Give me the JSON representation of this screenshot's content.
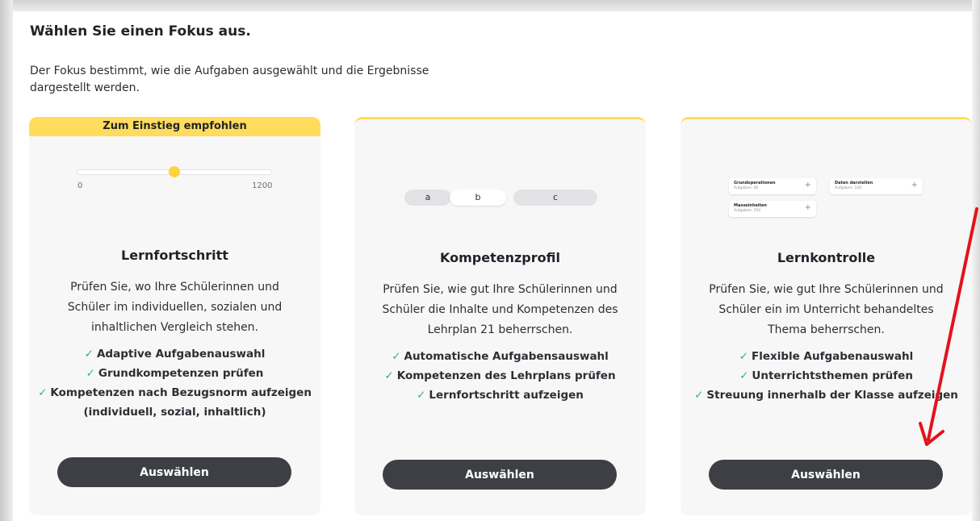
{
  "header": {
    "title": "Wählen Sie einen Fokus aus.",
    "description": "Der Fokus bestimmt, wie die Aufgaben ausgewählt und die Ergebnisse dargestellt werden."
  },
  "colors": {
    "accent_yellow": "#ffdc5c",
    "button_dark": "#3d3f44",
    "check_teal": "#2ab3a2",
    "arrow_red": "#e3131b"
  },
  "cards": [
    {
      "badge": "Zum Einstieg empfohlen",
      "illustration": {
        "slider_min": "0",
        "slider_max": "1200",
        "slider_value": 600
      },
      "title": "Lernfortschritt",
      "text": "Prüfen Sie, wo Ihre Schülerinnen und Schüler im individuellen, sozialen und inhaltlichen Vergleich stehen.",
      "features": [
        "Adaptive Aufgabenauswahl",
        "Grundkompetenzen prüfen",
        "Kompetenzen nach Bezugsnorm aufzeigen (individuell, sozial, inhaltlich)"
      ],
      "button": "Auswählen"
    },
    {
      "illustration": {
        "segments": [
          "a",
          "b",
          "c"
        ],
        "selected": "b"
      },
      "title": "Kompetenzprofil",
      "text": "Prüfen Sie, wie gut Ihre Schülerinnen und Schüler die Inhalte und Kompetenzen des Lehrplan 21 beherrschen.",
      "features": [
        "Automatische Aufgabensauswahl",
        "Kompetenzen des Lehrplans prüfen",
        "Lernfortschritt aufzeigen"
      ],
      "button": "Auswählen"
    },
    {
      "illustration": {
        "topics": [
          {
            "name": "Grundoperationen",
            "sub": "Aufgaben: 40"
          },
          {
            "name": "Daten darstellen",
            "sub": "Aufgaben: 120"
          },
          {
            "name": "Masseinheiten",
            "sub": "Aufgaben: 250"
          }
        ]
      },
      "title": "Lernkontrolle",
      "text": "Prüfen Sie, wie gut Ihre Schülerinnen und Schüler ein im Unterricht behandeltes Thema beherrschen.",
      "features": [
        "Flexible Aufgabenauswahl",
        "Unterrichtsthemen prüfen",
        "Streuung innerhalb der Klasse aufzeigen"
      ],
      "button": "Auswählen"
    }
  ]
}
